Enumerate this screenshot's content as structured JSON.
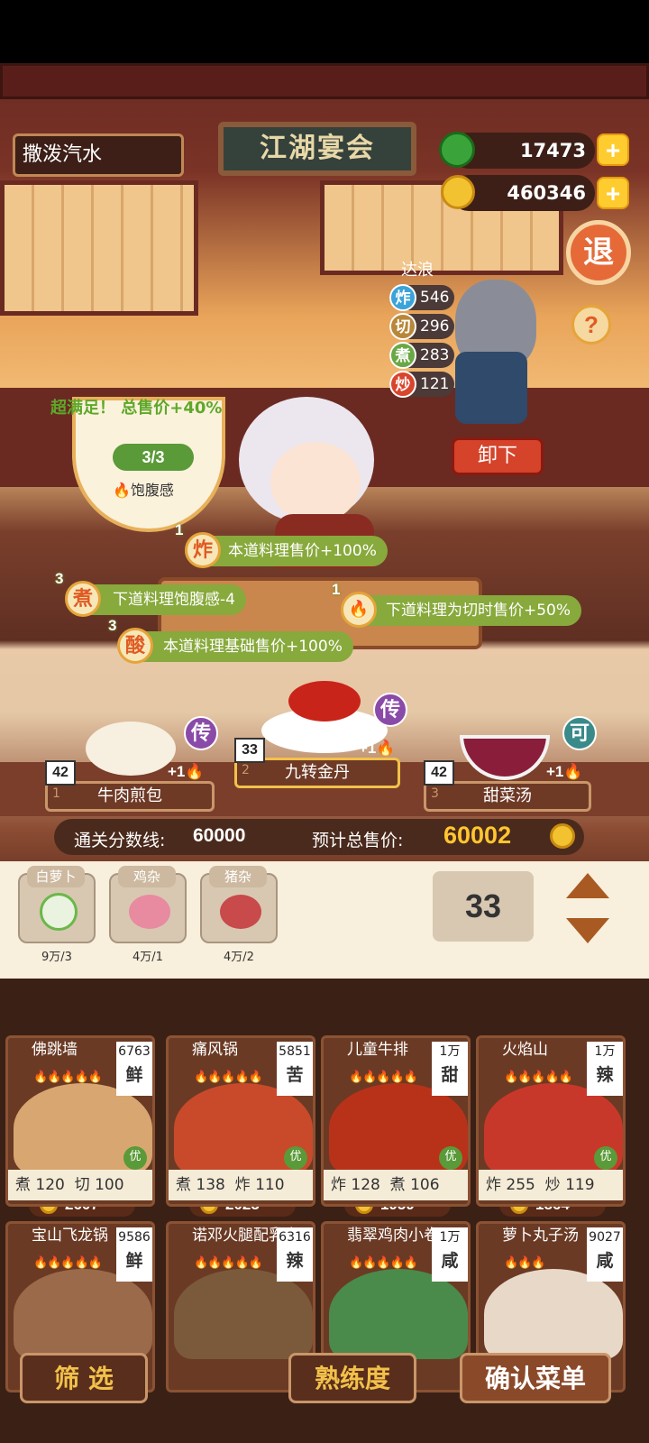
{
  "header": {
    "player_name": "撒泼汽水",
    "sign": "江湖宴会",
    "jade": "17473",
    "coins": "460346",
    "back_label": "退"
  },
  "chef": {
    "name": "达浪",
    "stats": [
      {
        "icon": "炸",
        "value": "546",
        "color": "#3ba3d9"
      },
      {
        "icon": "切",
        "value": "296",
        "color": "#b8873a"
      },
      {
        "icon": "煮",
        "value": "283",
        "color": "#6aa845"
      },
      {
        "icon": "炒",
        "value": "121",
        "color": "#d9452c"
      }
    ],
    "unload": "卸下"
  },
  "satisfaction": {
    "text": "超满足！ 总售价+40%",
    "progress": "3/3",
    "label": "饱腹感"
  },
  "effects": [
    {
      "n": "1",
      "icon": "炸",
      "text": "本道料理售价+100%"
    },
    {
      "n": "3",
      "icon": "煮",
      "text": "下道料理饱腹感-4"
    },
    {
      "n": "1",
      "icon": "🔥",
      "text": "下道料理为切时售价+50%"
    },
    {
      "n": "3",
      "icon": "酸",
      "text": "本道料理基础售价+100%"
    }
  ],
  "dishes": [
    {
      "idx": "1",
      "name": "牛肉煎包",
      "qty": "42",
      "badge": "传",
      "bonus": "+1"
    },
    {
      "idx": "2",
      "name": "九转金丹",
      "qty": "33",
      "badge": "传",
      "bonus": "+1"
    },
    {
      "idx": "3",
      "name": "甜菜汤",
      "qty": "42",
      "badge": "可",
      "bonus": "+1"
    }
  ],
  "score": {
    "pass_label": "通关分数线:",
    "pass_value": "60000",
    "total_label": "预计总售价:",
    "total_value": "60002"
  },
  "ingredients": [
    {
      "name": "白萝卜",
      "count": "9万/3"
    },
    {
      "name": "鸡杂",
      "count": "4万/1"
    },
    {
      "name": "猪杂",
      "count": "4万/2"
    }
  ],
  "quantity": "33",
  "recipes": [
    {
      "name": "佛跳墙",
      "price": "6763",
      "taste": "鲜",
      "s1": "煮",
      "v1": "120",
      "s2": "切",
      "v2": "100",
      "sale": "2607",
      "flames": "🔥🔥🔥🔥🔥",
      "good": "优"
    },
    {
      "name": "痛风锅",
      "price": "5851",
      "taste": "苦",
      "s1": "煮",
      "v1": "138",
      "s2": "炸",
      "v2": "110",
      "sale": "2023",
      "flames": "🔥🔥🔥🔥🔥",
      "good": "优"
    },
    {
      "name": "儿童牛排",
      "price": "1万",
      "taste": "甜",
      "s1": "炸",
      "v1": "128",
      "s2": "煮",
      "v2": "106",
      "sale": "1959",
      "flames": "🔥🔥🔥🔥🔥",
      "good": "优"
    },
    {
      "name": "火焰山",
      "price": "1万",
      "taste": "辣",
      "s1": "炸",
      "v1": "255",
      "s2": "炒",
      "v2": "119",
      "sale": "1864",
      "flames": "🔥🔥🔥🔥🔥",
      "good": "优"
    },
    {
      "name": "宝山飞龙锅",
      "price": "9586",
      "taste": "鲜",
      "flames": "🔥🔥🔥🔥🔥"
    },
    {
      "name": "诺邓火腿配乳扇",
      "price": "6316",
      "taste": "辣",
      "flames": "🔥🔥🔥🔥🔥"
    },
    {
      "name": "翡翠鸡肉小卷",
      "price": "1万",
      "taste": "咸",
      "flames": "🔥🔥🔥🔥🔥"
    },
    {
      "name": "萝卜丸子汤",
      "price": "9027",
      "taste": "咸",
      "flames": "🔥🔥🔥"
    }
  ],
  "buttons": {
    "filter": "筛 选",
    "proficiency": "熟练度",
    "confirm": "确认菜单"
  }
}
